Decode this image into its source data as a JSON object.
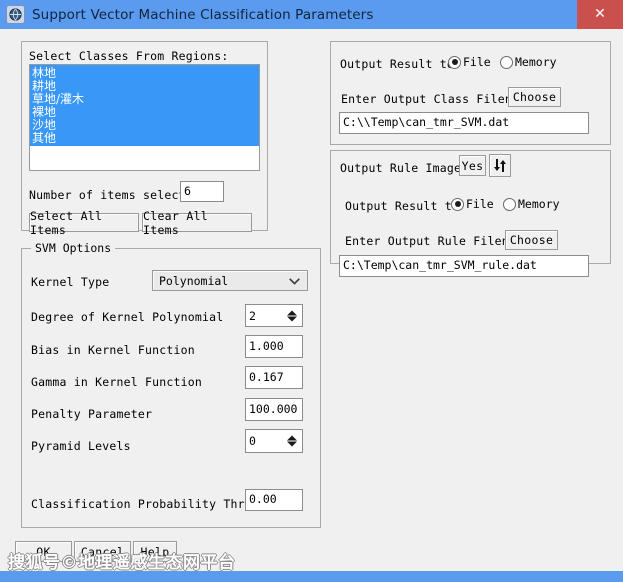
{
  "window": {
    "title": "Support Vector Machine Classification Parameters",
    "icon": "app-globe-icon",
    "close_label": "✕",
    "titlebar_color": "#5b9bef",
    "close_color": "#c9504d",
    "selection_color": "#3897f7"
  },
  "classes_panel": {
    "heading": "Select Classes From Regions:",
    "items": [
      {
        "label": "林地",
        "selected": true
      },
      {
        "label": "耕地",
        "selected": true
      },
      {
        "label": "草地/灌木",
        "selected": true
      },
      {
        "label": "裸地",
        "selected": true
      },
      {
        "label": "沙地",
        "selected": true
      },
      {
        "label": "其他",
        "selected": true
      }
    ],
    "count_label": "Number of items selected:",
    "count_value": "6",
    "select_all_label": "Select All Items",
    "clear_all_label": "Clear All Items"
  },
  "svm_options": {
    "legend": "SVM Options",
    "kernel_type_label": "Kernel Type",
    "kernel_type_value": "Polynomial",
    "degree_label": "Degree of Kernel Polynomial",
    "degree_value": "2",
    "bias_label": "Bias in Kernel Function",
    "bias_value": "1.000",
    "gamma_label": "Gamma in Kernel Function",
    "gamma_value": "0.167",
    "penalty_label": "Penalty Parameter",
    "penalty_value": "100.000",
    "pyramid_label": "Pyramid Levels",
    "pyramid_value": "0",
    "threshold_label": "Classification Probability Threshold",
    "threshold_value": "0.00"
  },
  "output_class": {
    "output_to_label": "Output Result to",
    "file_label": "File",
    "memory_label": "Memory",
    "file_selected": true,
    "filename_label": "Enter Output Class Filename",
    "choose_label": "Choose",
    "filename_value": "C:\\\\Temp\\can_tmr_SVM.dat"
  },
  "output_rule": {
    "rule_images_label": "Output Rule Images ?",
    "rule_images_value": "Yes",
    "toggle_icon": "up-down-arrows-icon",
    "output_to_label": "Output Result to",
    "file_label": "File",
    "memory_label": "Memory",
    "file_selected": true,
    "filename_label": "Enter Output Rule Filename",
    "choose_label": "Choose",
    "filename_value": "C:\\Temp\\can_tmr_SVM_rule.dat"
  },
  "footer": {
    "ok_label": "OK",
    "cancel_label": "Cancel",
    "help_label": "Help",
    "watermark": "搜狐号©地理遥感生态网平台"
  }
}
